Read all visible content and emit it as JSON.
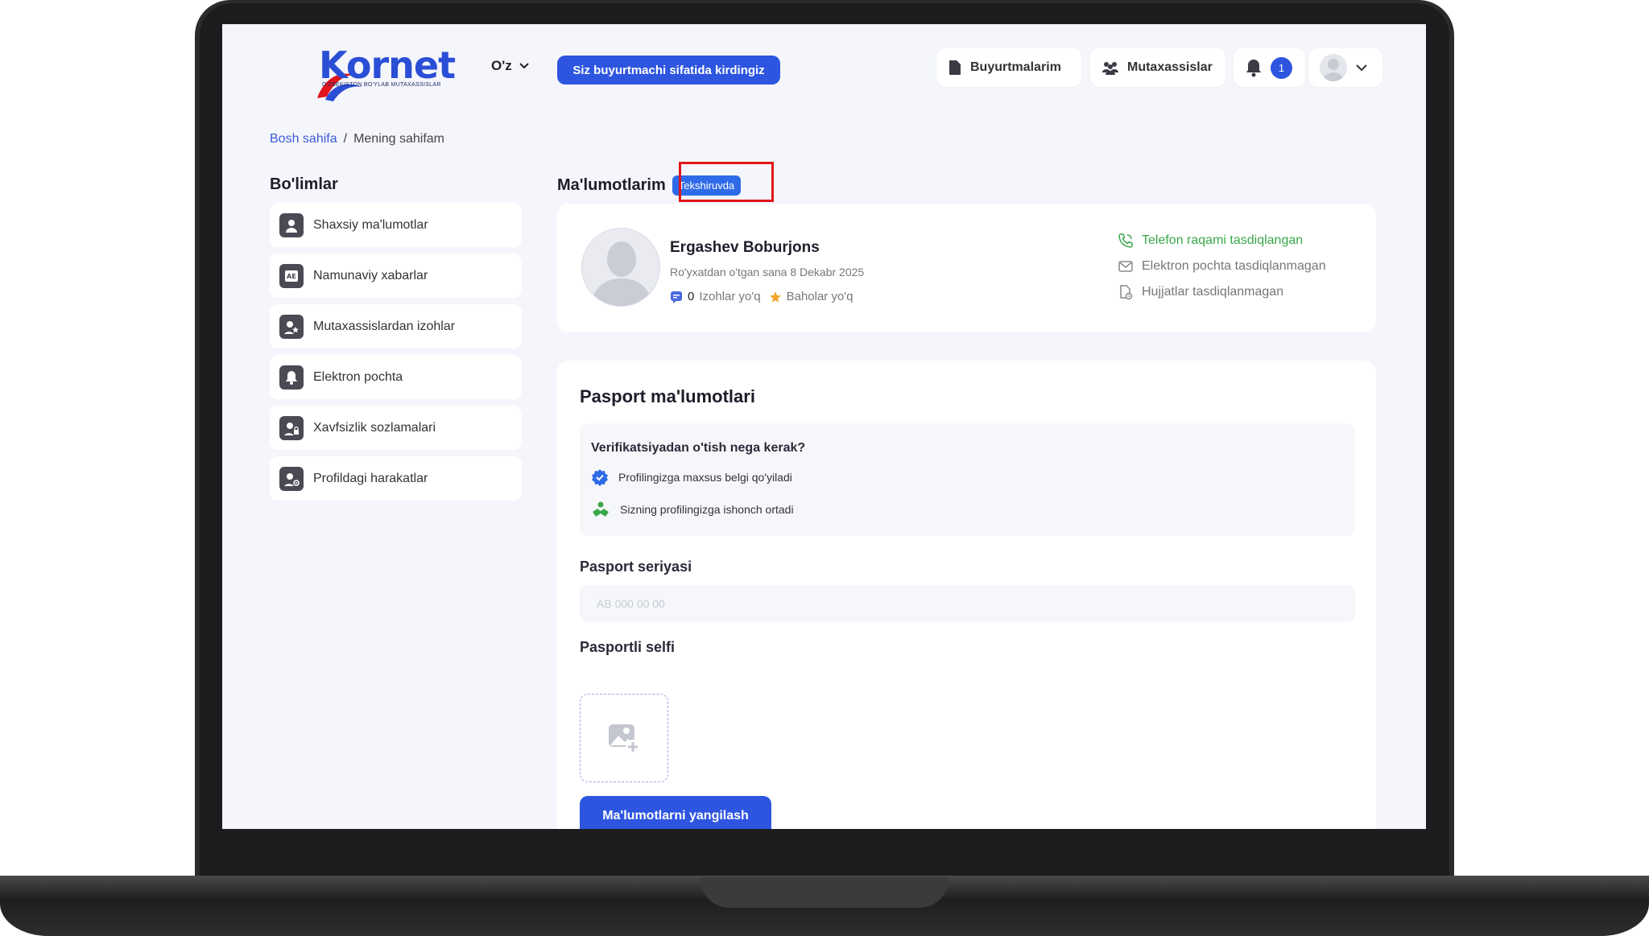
{
  "header": {
    "logo_text": "Kornet",
    "logo_subtitle": "O'ZBEKISTON BO'YLAB MUTAXASSISLAR",
    "language": "O'z",
    "role_notice": "Siz buyurtmachi sifatida kirdingiz",
    "orders_label": "Buyurtmalarim",
    "experts_label": "Mutaxassislar",
    "notification_count": "1",
    "icons": [
      "file-icon",
      "people-icon",
      "bell-icon",
      "avatar",
      "chevron-down-icon"
    ]
  },
  "breadcrumb": {
    "home": "Bosh sahifa",
    "separator": "/",
    "current": "Mening sahifam"
  },
  "sidebar": {
    "title": "Bo'limlar",
    "items": [
      {
        "label": "Shaxsiy ma'lumotlar",
        "icon": "person-icon"
      },
      {
        "label": "Namunaviy xabarlar",
        "icon": "message-template-icon"
      },
      {
        "label": "Mutaxassislardan izohlar",
        "icon": "person-star-icon"
      },
      {
        "label": "Elektron pochta",
        "icon": "bell-icon"
      },
      {
        "label": "Xavfsizlik sozlamalari",
        "icon": "person-lock-icon"
      },
      {
        "label": "Profildagi harakatlar",
        "icon": "person-gear-icon"
      }
    ]
  },
  "main": {
    "title": "Ma'lumotlarim",
    "status": "Tekshiruvda",
    "profile": {
      "name": "Ergashev Boburjons",
      "registered": "Ro'yxatdan o'tgan sana 8 Dekabr 2025",
      "reviews_count": "0",
      "reviews_label": "Izohlar yo'q",
      "ratings_label": "Baholar yo'q",
      "verifications": [
        {
          "label": "Telefon raqami tasdiqlangan",
          "status": "ok",
          "icon": "phone-icon"
        },
        {
          "label": "Elektron pochta tasdiqlanmagan",
          "status": "pending",
          "icon": "mail-icon"
        },
        {
          "label": "Hujjatlar tasdiqlanmagan",
          "status": "pending",
          "icon": "document-icon"
        }
      ]
    },
    "passport": {
      "title": "Pasport ma'lumotlari",
      "why_title": "Verifikatsiyadan o'tish nega kerak?",
      "why_items": [
        {
          "label": "Profilingizga maxsus belgi qo'yiladi",
          "icon": "verified-badge-icon"
        },
        {
          "label": "Sizning profilingizga ishonch ortadi",
          "icon": "handshake-icon"
        }
      ],
      "series_label": "Pasport seriyasi",
      "series_value": "",
      "series_placeholder": "AB 000 00 00",
      "selfie_label": "Pasportli selfi",
      "submit_label": "Ma'lumotlarni yangilash"
    }
  },
  "colors": {
    "primary": "#2d55e0",
    "status": "#2f6be8",
    "highlight": "#e2141c",
    "success": "#3aa84a",
    "background": "#f5f6fb"
  }
}
